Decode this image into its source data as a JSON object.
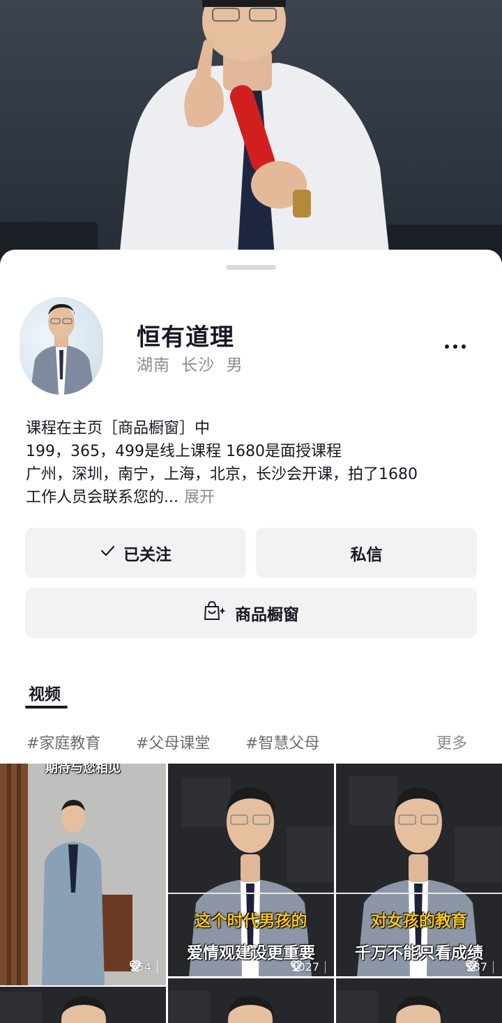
{
  "profile": {
    "name": "恒有道理",
    "location_province": "湖南",
    "location_city": "长沙",
    "gender": "男",
    "more_icon": "more-horizontal-icon"
  },
  "bio": {
    "line1": "课程在主页［商品橱窗］中",
    "line2": "199，365，499是线上课程 1680是面授课程",
    "line3": "广州，深圳，南宁，上海，北京，长沙会开课，拍了1680",
    "line4": "工作人员会联系您的...",
    "expand_label": "展开"
  },
  "actions": {
    "follow_label": "已关注",
    "follow_icon": "check-icon",
    "message_label": "私信",
    "shop_label": "商品橱窗",
    "shop_icon": "shopping-bag-icon"
  },
  "tabs": {
    "video_label": "视频"
  },
  "tags": {
    "items": [
      "#家庭教育",
      "#父母课堂",
      "#智慧父母"
    ],
    "more_label": "更多"
  },
  "videos": [
    {
      "top_caption": "期待与您相见",
      "caption_line1": "",
      "caption_line2": "",
      "likes": "254"
    },
    {
      "top_caption": "",
      "caption_line1": "这个时代男孩的",
      "caption_line2": "爱情观建设更重要",
      "likes": "1027"
    },
    {
      "top_caption": "",
      "caption_line1": "对女孩的教育",
      "caption_line2": "千万不能只看成绩",
      "likes": "287"
    }
  ],
  "colors": {
    "caption_yellow": "#f7c41c",
    "button_bg": "#f2f2f4",
    "text_primary": "#161823",
    "text_secondary": "#8a8b91"
  }
}
